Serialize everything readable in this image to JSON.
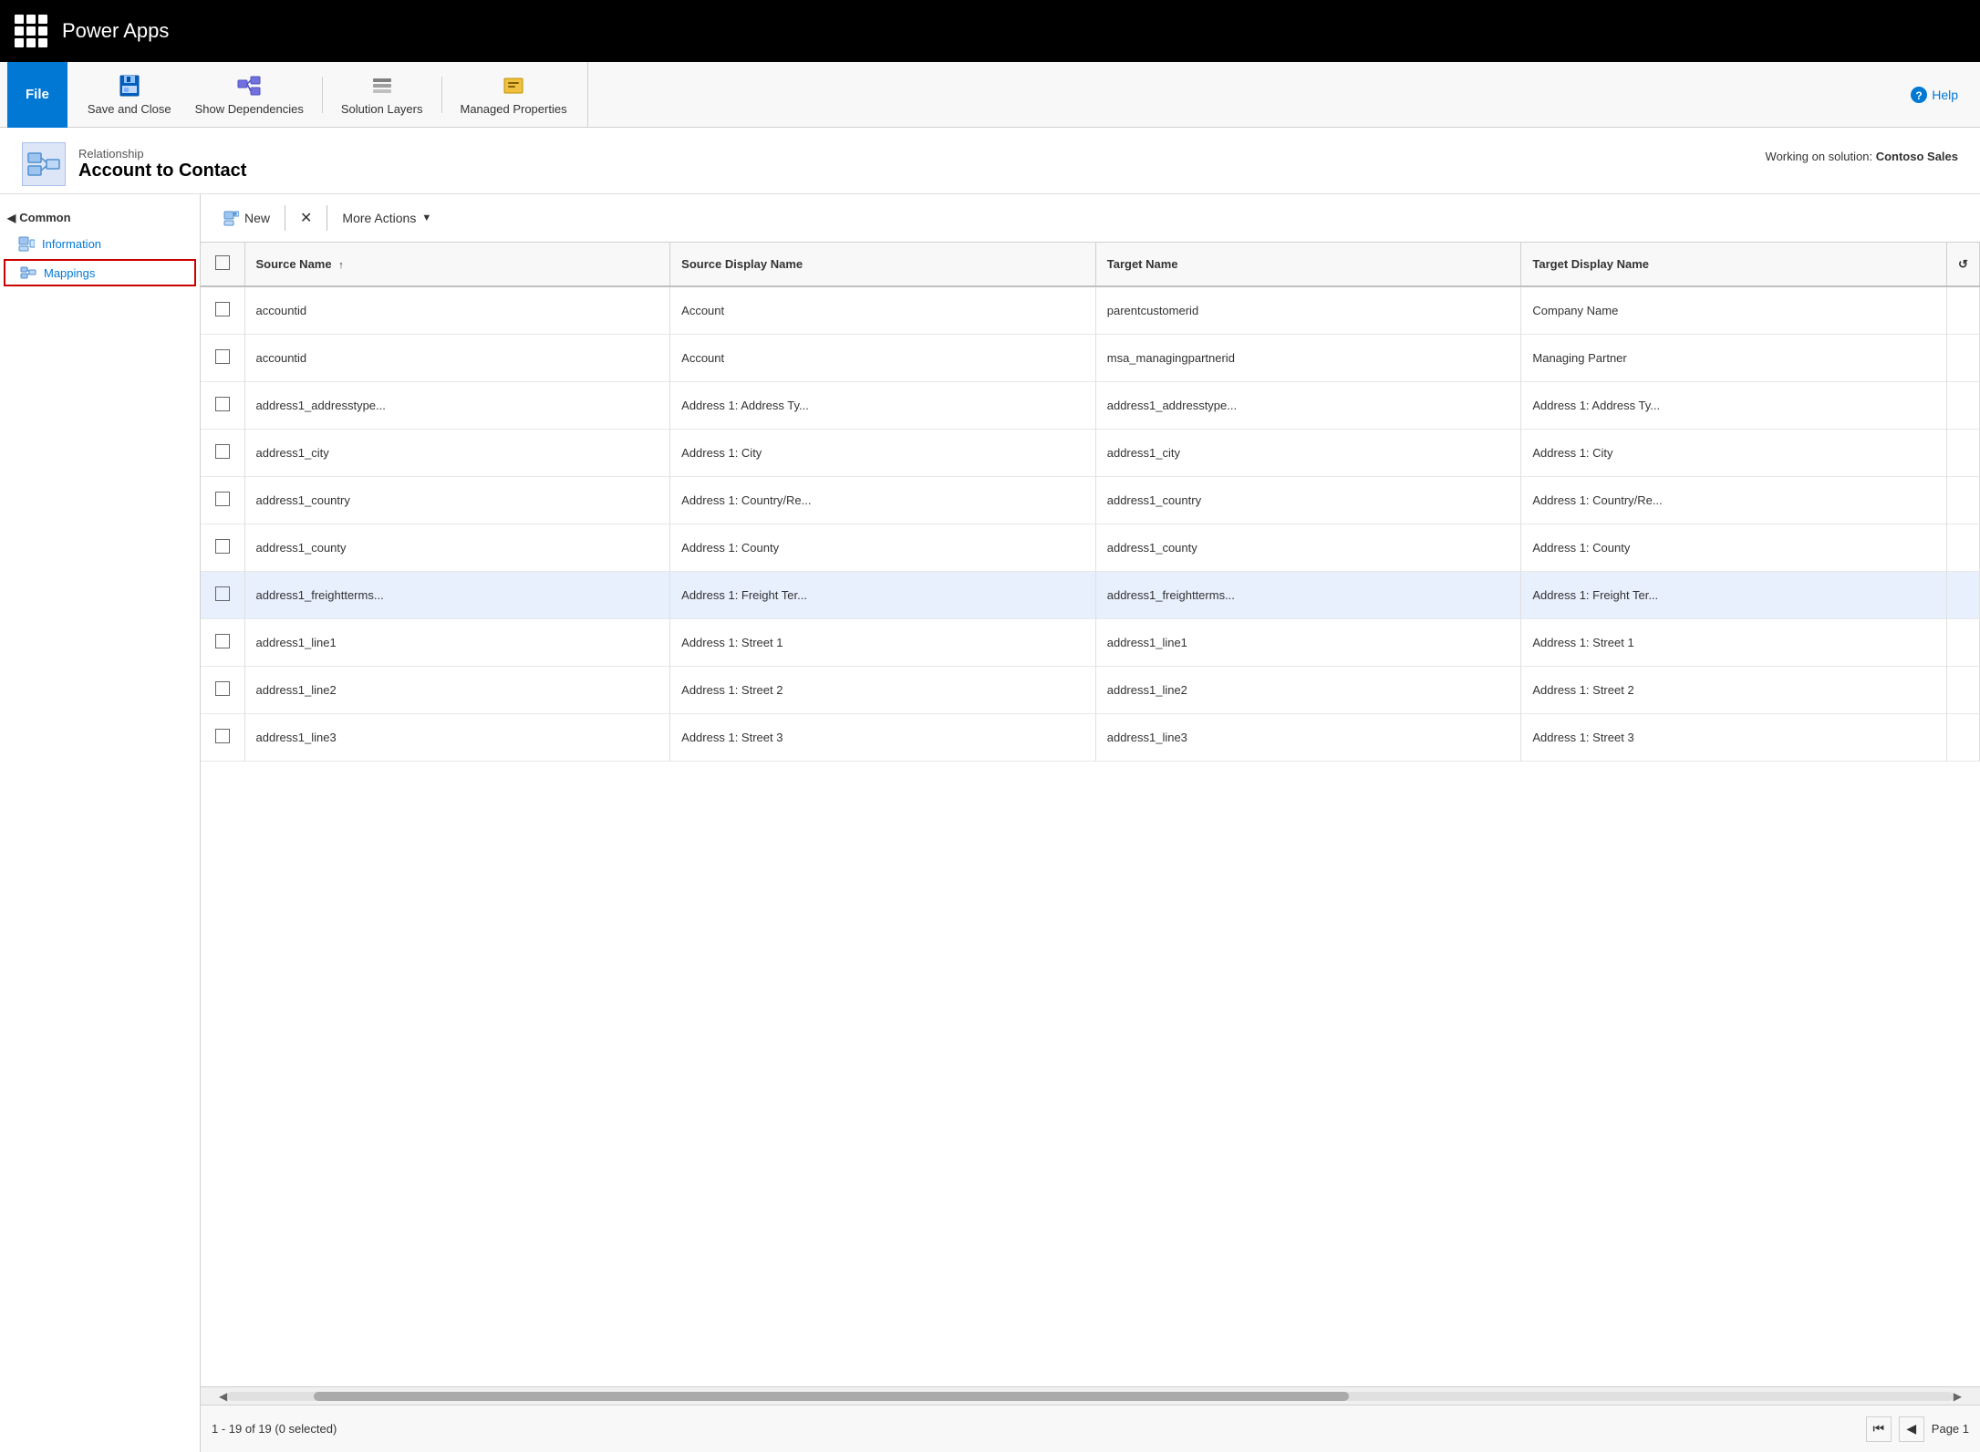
{
  "app": {
    "title": "Power Apps"
  },
  "ribbon": {
    "file_label": "File",
    "save_close_label": "Save and Close",
    "show_deps_label": "Show Dependencies",
    "solution_layers_label": "Solution Layers",
    "managed_props_label": "Managed Properties",
    "help_label": "Help"
  },
  "page_header": {
    "label": "Relationship",
    "title": "Account to Contact",
    "working_on_prefix": "Working on solution:",
    "working_on_name": "Contoso Sales"
  },
  "sidebar": {
    "section": "Common",
    "items": [
      {
        "id": "information",
        "label": "Information"
      },
      {
        "id": "mappings",
        "label": "Mappings"
      }
    ]
  },
  "toolbar": {
    "new_label": "New",
    "delete_label": "✕",
    "more_actions_label": "More Actions"
  },
  "grid": {
    "columns": [
      {
        "id": "select",
        "label": ""
      },
      {
        "id": "source_name",
        "label": "Source Name",
        "sortable": true,
        "sort_dir": "asc"
      },
      {
        "id": "source_display_name",
        "label": "Source Display Name"
      },
      {
        "id": "target_name",
        "label": "Target Name"
      },
      {
        "id": "target_display_name",
        "label": "Target Display Name"
      },
      {
        "id": "refresh",
        "label": "↺"
      }
    ],
    "rows": [
      {
        "id": 1,
        "selected": false,
        "source_name": "accountid",
        "source_display_name": "Account",
        "target_name": "parentcustomerid",
        "target_display_name": "Company Name"
      },
      {
        "id": 2,
        "selected": false,
        "source_name": "accountid",
        "source_display_name": "Account",
        "target_name": "msa_managingpartnerid",
        "target_display_name": "Managing Partner"
      },
      {
        "id": 3,
        "selected": false,
        "source_name": "address1_addresstype...",
        "source_display_name": "Address 1: Address Ty...",
        "target_name": "address1_addresstype...",
        "target_display_name": "Address 1: Address Ty..."
      },
      {
        "id": 4,
        "selected": false,
        "source_name": "address1_city",
        "source_display_name": "Address 1: City",
        "target_name": "address1_city",
        "target_display_name": "Address 1: City"
      },
      {
        "id": 5,
        "selected": false,
        "source_name": "address1_country",
        "source_display_name": "Address 1: Country/Re...",
        "target_name": "address1_country",
        "target_display_name": "Address 1: Country/Re..."
      },
      {
        "id": 6,
        "selected": false,
        "source_name": "address1_county",
        "source_display_name": "Address 1: County",
        "target_name": "address1_county",
        "target_display_name": "Address 1: County"
      },
      {
        "id": 7,
        "selected": false,
        "source_name": "address1_freightterms...",
        "source_display_name": "Address 1: Freight Ter...",
        "target_name": "address1_freightterms...",
        "target_display_name": "Address 1: Freight Ter...",
        "highlighted": true
      },
      {
        "id": 8,
        "selected": false,
        "source_name": "address1_line1",
        "source_display_name": "Address 1: Street 1",
        "target_name": "address1_line1",
        "target_display_name": "Address 1: Street 1"
      },
      {
        "id": 9,
        "selected": false,
        "source_name": "address1_line2",
        "source_display_name": "Address 1: Street 2",
        "target_name": "address1_line2",
        "target_display_name": "Address 1: Street 2"
      },
      {
        "id": 10,
        "selected": false,
        "source_name": "address1_line3",
        "source_display_name": "Address 1: Street 3",
        "target_name": "address1_line3",
        "target_display_name": "Address 1: Street 3"
      }
    ],
    "footer": {
      "count_label": "1 - 19 of 19 (0 selected)",
      "page_label": "Page 1"
    }
  }
}
